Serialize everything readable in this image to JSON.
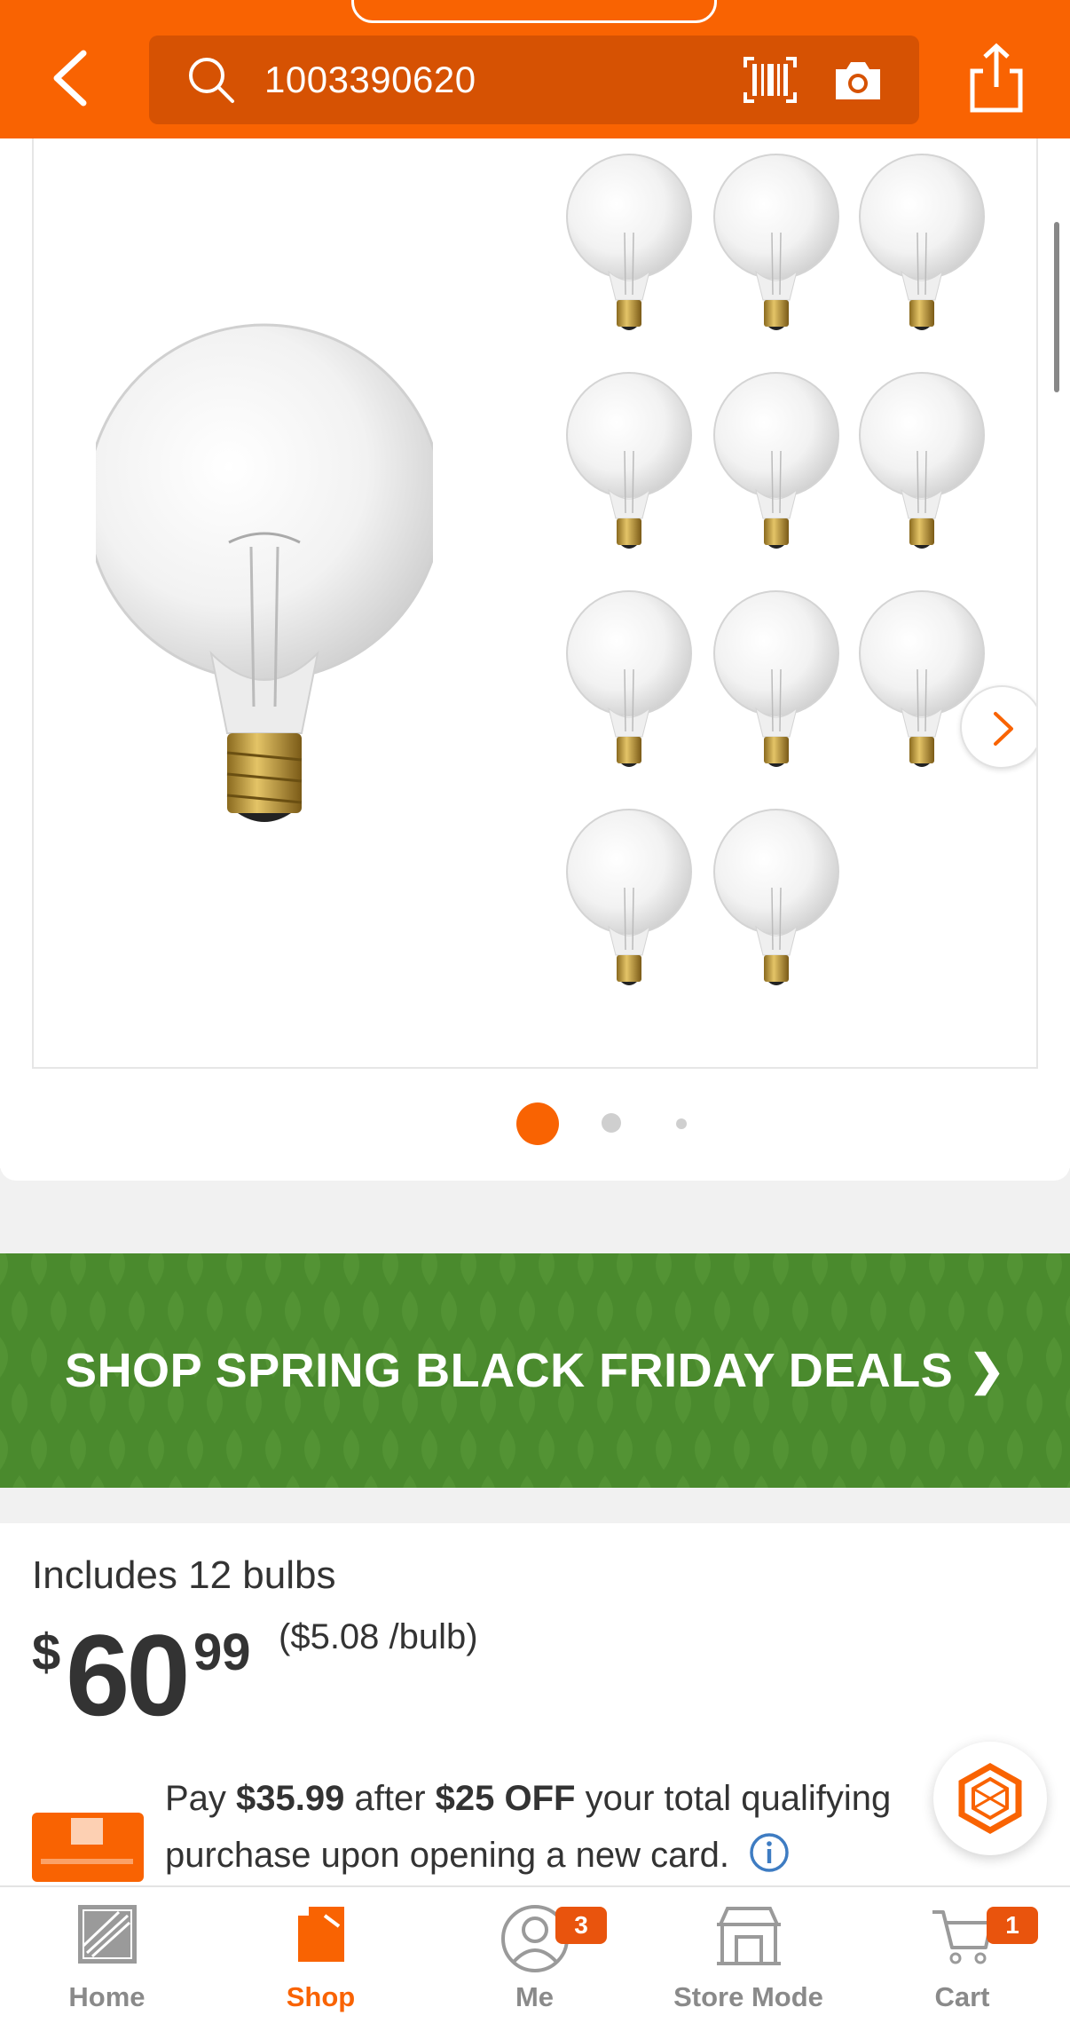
{
  "header": {
    "search_query": "1003390620",
    "icons": [
      "back-arrow-icon",
      "search-icon",
      "barcode-icon",
      "camera-icon",
      "share-icon"
    ]
  },
  "gallery": {
    "current_page": 1,
    "page_count": 3
  },
  "promo": {
    "label": "SHOP SPRING BLACK FRIDAY DEALS",
    "chevron": "❯"
  },
  "product": {
    "includes": "Includes 12 bulbs",
    "price_dollar_sign": "$",
    "price_whole": "60",
    "price_cents": "99",
    "price_per_unit": "($5.08 /bulb)"
  },
  "card_offer": {
    "prefix": "Pay ",
    "pay_amount": "$35.99",
    "middle": " after ",
    "discount": "$25 OFF",
    "suffix": " your total qualifying purchase upon opening a new card."
  },
  "bottom_nav": {
    "items": [
      {
        "label": "Home",
        "icon": "home-depot-logo-icon",
        "active": false
      },
      {
        "label": "Shop",
        "icon": "shop-bag-icon",
        "active": true
      },
      {
        "label": "Me",
        "icon": "user-icon",
        "active": false,
        "badge": "3"
      },
      {
        "label": "Store Mode",
        "icon": "store-icon",
        "active": false
      },
      {
        "label": "Cart",
        "icon": "cart-icon",
        "active": false,
        "badge": "1"
      }
    ]
  },
  "colors": {
    "brand_orange": "#f96302",
    "promo_green": "#4a8a2d",
    "text": "#333333",
    "nav_inactive": "#8a8a8a"
  }
}
